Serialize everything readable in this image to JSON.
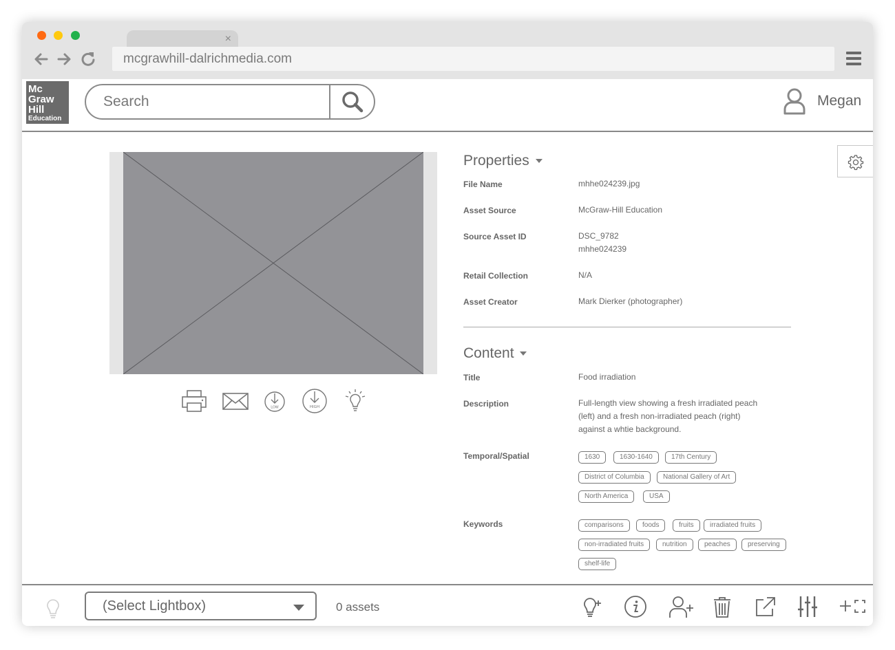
{
  "browser": {
    "url": "mcgrawhill-dalrichmedia.com",
    "tab_close": "×",
    "dots": [
      "#ff6a12",
      "#ffc90e",
      "#22b14c"
    ]
  },
  "header": {
    "logo_lines": [
      "Mc",
      "Graw",
      "Hill",
      "Education"
    ],
    "search_placeholder": "Search",
    "user_name": "Megan"
  },
  "actions": [
    "print-icon",
    "email-icon",
    "download-low-icon",
    "download-high-icon",
    "lightbulb-icon"
  ],
  "download_low_label": "LOW",
  "download_high_label": "HIGH",
  "properties": {
    "heading": "Properties",
    "rows": [
      {
        "label": "File Name",
        "value": "mhhe024239.jpg"
      },
      {
        "label": "Asset Source",
        "value": "McGraw-Hill Education"
      },
      {
        "label": "Source Asset ID",
        "value": "DSC_9782",
        "value2": "mhhe024239"
      },
      {
        "label": "Retail Collection",
        "value": "N/A"
      },
      {
        "label": "Asset Creator",
        "value": "Mark Dierker (photographer)"
      }
    ]
  },
  "content": {
    "heading": "Content",
    "title_label": "Title",
    "title_value": "Food irradiation",
    "description_label": "Description",
    "description_lines": [
      "Full-length view showing a fresh irradiated peach",
      "(left) and a fresh non-irradiated peach (right)",
      "against a whtie background."
    ],
    "temporal_label": "Temporal/Spatial",
    "temporal_tags": [
      "1630",
      "1630-1640",
      "17th Century",
      "District of Columbia",
      "National Gallery of Art",
      "North America",
      "USA"
    ],
    "keywords_label": "Keywords",
    "keyword_tags": [
      "comparisons",
      "foods",
      "fruits",
      "irradiated fruits",
      "non-irradiated fruits",
      "nutrition",
      "peaches",
      "preserving",
      "shelf-life"
    ]
  },
  "footer": {
    "lightbox_placeholder": "(Select Lightbox)",
    "asset_count": "0 assets",
    "tools": [
      "add-idea-icon",
      "info-icon",
      "add-user-icon",
      "trash-icon",
      "share-icon",
      "adjust-icon",
      "add-fullscreen-icon"
    ]
  }
}
